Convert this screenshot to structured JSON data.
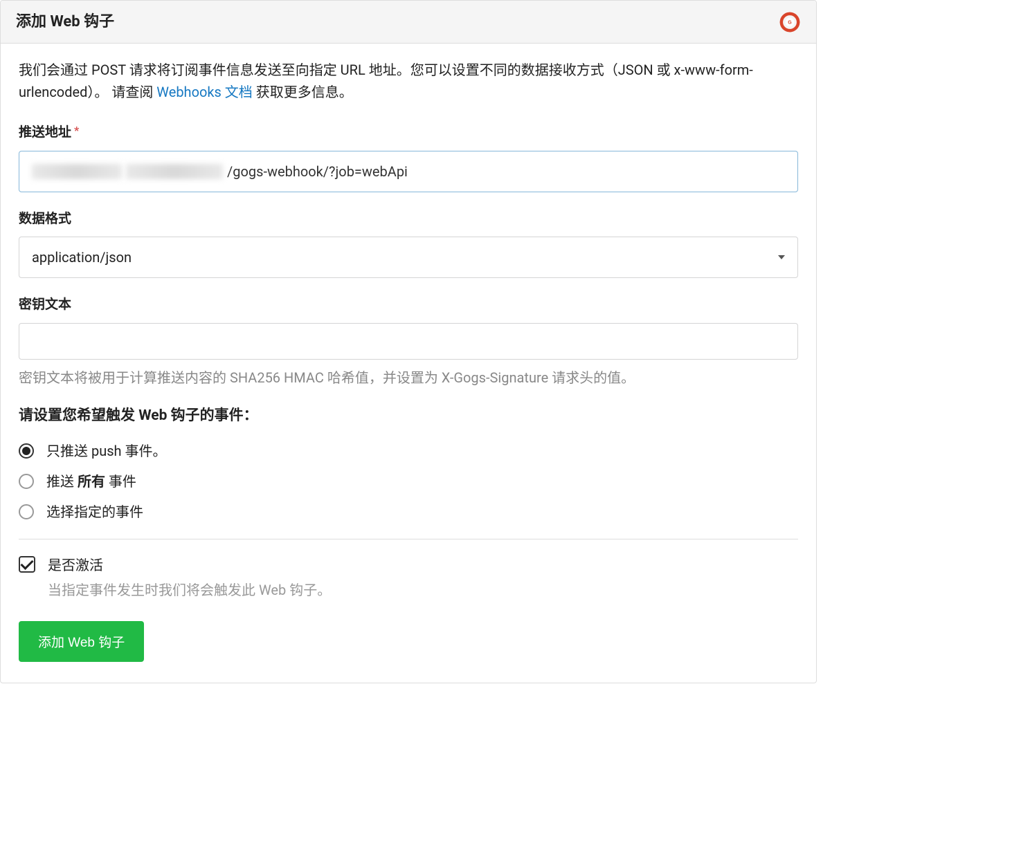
{
  "header": {
    "title": "添加 Web 钩子"
  },
  "intro": {
    "before": "我们会通过 POST 请求将订阅事件信息发送至向指定 URL 地址。您可以设置不同的数据接收方式（JSON 或 x-www-form-urlencoded）。 请查阅 ",
    "link": "Webhooks 文档",
    "after": " 获取更多信息。"
  },
  "url_field": {
    "label": "推送地址",
    "value_suffix": "/gogs-webhook/?job=webApi"
  },
  "format_field": {
    "label": "数据格式",
    "selected": "application/json"
  },
  "secret_field": {
    "label": "密钥文本",
    "value": "",
    "help": "密钥文本将被用于计算推送内容的 SHA256 HMAC 哈希值，并设置为 X-Gogs-Signature 请求头的值。"
  },
  "events": {
    "heading": "请设置您希望触发 Web 钩子的事件：",
    "options": [
      {
        "label_before": "只推送 ",
        "label_strong": "push",
        "label_after": " 事件。",
        "checked": true
      },
      {
        "label_before": "推送 ",
        "label_strong": "所有",
        "label_after": " 事件",
        "checked": false
      },
      {
        "label_before": "选择指定的事件",
        "label_strong": "",
        "label_after": "",
        "checked": false
      }
    ]
  },
  "active": {
    "label": "是否激活",
    "help": "当指定事件发生时我们将会触发此 Web 钩子。",
    "checked": true
  },
  "submit": {
    "label": "添加 Web 钩子"
  }
}
